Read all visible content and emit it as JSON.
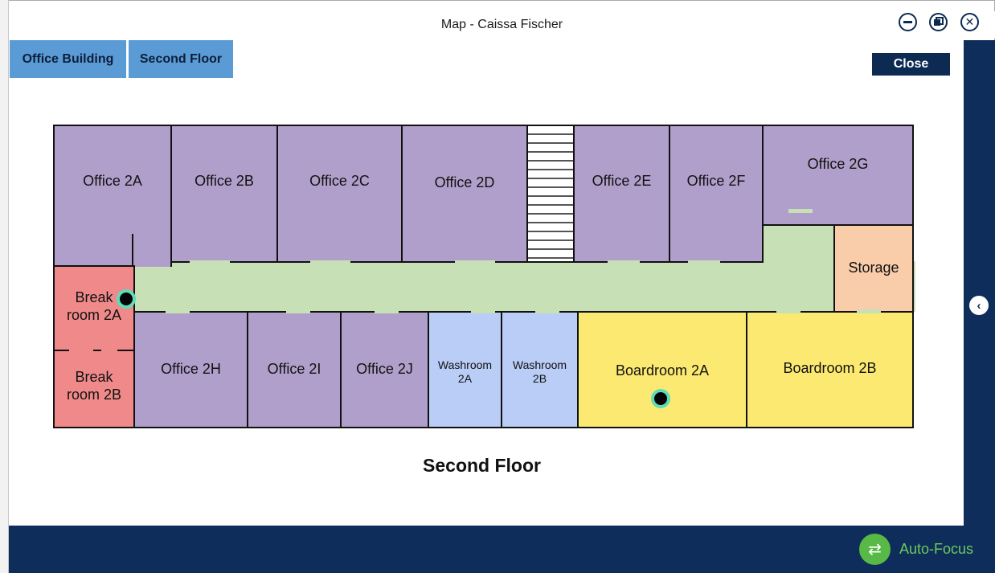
{
  "window": {
    "title": "Map - Caissa Fischer"
  },
  "breadcrumb": {
    "building": "Office Building",
    "floor": "Second Floor"
  },
  "actions": {
    "close_label": "Close",
    "autofocus_label": "Auto-Focus"
  },
  "floor_plan": {
    "title": "Second Floor",
    "rooms": {
      "office_2a": "Office 2A",
      "office_2b": "Office 2B",
      "office_2c": "Office 2C",
      "office_2d": "Office 2D",
      "office_2e": "Office 2E",
      "office_2f": "Office 2F",
      "office_2g": "Office 2G",
      "storage": "Storage",
      "break_2a_line1": "Break",
      "break_2a_line2": "room 2A",
      "break_2b_line1": "Break",
      "break_2b_line2": "room 2B",
      "office_2h": "Office 2H",
      "office_2i": "Office 2I",
      "office_2j": "Office 2J",
      "washroom_2a_line1": "Washroom",
      "washroom_2a_line2": "2A",
      "washroom_2b_line1": "Washroom",
      "washroom_2b_line2": "2B",
      "boardroom_2a": "Boardroom 2A",
      "boardroom_2b": "Boardroom 2B"
    }
  },
  "colors": {
    "office": "#b19fcb",
    "break_room": "#f08a8a",
    "washroom": "#b9cdf6",
    "boardroom": "#fbe972",
    "storage": "#f9ccaa",
    "corridor": "#c7e0b6",
    "accent_dark": "#0e2d5a",
    "crumb_blue": "#5b9bd5",
    "autofocus_green": "#58b947",
    "marker_ring": "#5fdcb8"
  },
  "icons": {
    "minimize": "minimize-icon",
    "restore": "restore-icon",
    "close": "close-icon",
    "collapse": "chevron-left-icon",
    "autofocus": "swap-arrows-icon",
    "marker": "location-marker-icon"
  }
}
